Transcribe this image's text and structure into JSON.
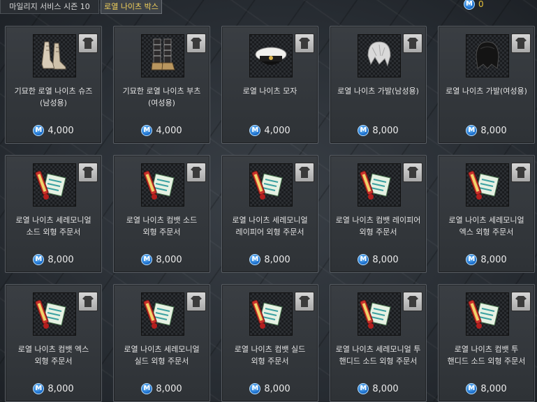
{
  "tabs": [
    {
      "label": "마일리지 서비스 시즌 10",
      "active": false
    },
    {
      "label": "로열 나이츠 박스",
      "active": true
    }
  ],
  "points": {
    "currency_icon": "maple-point-icon",
    "value": "0"
  },
  "items": [
    {
      "name": "기묘한 로열 나이츠 슈즈(남성용)",
      "price": "4,000",
      "icon": "shoes-icon"
    },
    {
      "name": "기묘한 로열 나이츠 부츠(여성용)",
      "price": "4,000",
      "icon": "boots-icon"
    },
    {
      "name": "로열 나이츠 모자",
      "price": "4,000",
      "icon": "cap-icon"
    },
    {
      "name": "로열 나이츠 가발(남성용)",
      "price": "8,000",
      "icon": "wig-silver-icon"
    },
    {
      "name": "로열 나이츠 가발(여성용)",
      "price": "8,000",
      "icon": "wig-black-icon"
    },
    {
      "name": "로열 나이츠 세레모니얼 소드 외형 주문서",
      "price": "8,000",
      "icon": "scroll-icon"
    },
    {
      "name": "로열 나이츠 컴뱃 소드 외형 주문서",
      "price": "8,000",
      "icon": "scroll-icon"
    },
    {
      "name": "로열 나이츠 세레모니얼 레이피어 외형 주문서",
      "price": "8,000",
      "icon": "scroll-icon"
    },
    {
      "name": "로열 나이츠 컴뱃 레이피어 외형 주문서",
      "price": "8,000",
      "icon": "scroll-icon"
    },
    {
      "name": "로열 나이츠 세레모니얼 엑스 외형 주문서",
      "price": "8,000",
      "icon": "scroll-icon"
    },
    {
      "name": "로열 나이츠 컴뱃 엑스 외형 주문서",
      "price": "8,000",
      "icon": "scroll-icon"
    },
    {
      "name": "로열 나이츠 세레모니얼 실드 외형 주문서",
      "price": "8,000",
      "icon": "scroll-icon"
    },
    {
      "name": "로열 나이츠 컴뱃 실드 외형 주문서",
      "price": "8,000",
      "icon": "scroll-icon"
    },
    {
      "name": "로열 나이츠 세레모니얼 투 핸디드 소드 외형 주문서",
      "price": "8,000",
      "icon": "scroll-icon"
    },
    {
      "name": "로열 나이츠 컴뱃 투 핸디드 소드 외형 주문서",
      "price": "8,000",
      "icon": "scroll-icon"
    }
  ],
  "colors": {
    "price_icon": "#1f74d1",
    "active_tab_text": "#f2d15c",
    "points_text": "#e9c33a"
  }
}
